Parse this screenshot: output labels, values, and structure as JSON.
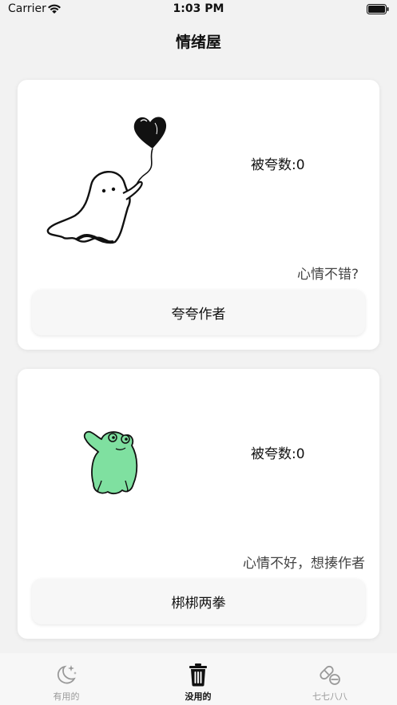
{
  "status_bar": {
    "carrier": "Carrier",
    "time": "1:03 PM"
  },
  "nav": {
    "title": "情绪屋"
  },
  "cards": [
    {
      "illustration": "ghost-with-heart-balloon",
      "praise_count": "被夸数:0",
      "mood_text": "心情不错?",
      "button_label": "夸夸作者"
    },
    {
      "illustration": "green-frog",
      "praise_count": "被夸数:0",
      "mood_text": "心情不好，想揍作者",
      "button_label": "梆梆两拳"
    }
  ],
  "tab_bar": {
    "tabs": [
      {
        "label": "有用的",
        "icon": "moon-sparkle-icon",
        "active": false
      },
      {
        "label": "没用的",
        "icon": "trash-icon",
        "active": true
      },
      {
        "label": "七七八八",
        "icon": "pill-icon",
        "active": false
      }
    ]
  },
  "colors": {
    "background": "#f2f2f2",
    "card": "#ffffff",
    "button": "#f7f7f7",
    "frog_green": "#7fe0a0",
    "tab_inactive": "#999999",
    "tab_active": "#111111"
  }
}
